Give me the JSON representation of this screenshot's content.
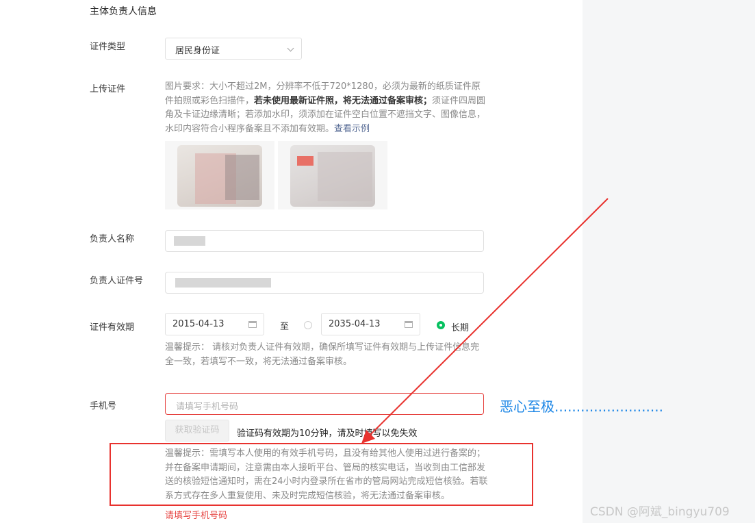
{
  "section_title": "主体负责人信息",
  "id_type": {
    "label": "证件类型",
    "value": "居民身份证"
  },
  "upload": {
    "label": "上传证件",
    "hint_part1": "图片要求：大小不超过2M，分辨率不低于720*1280，必须为最新的纸质证件原件拍照或彩色扫描件，",
    "hint_bold": "若未使用最新证件照，将无法通过备案审核；",
    "hint_part2": "须证件四周圆角及卡证边缘清晰；若添加水印，须添加在证件空白位置不遮挡文字、图像信息，水印内容符合小程序备案且不添加有效期。",
    "example_link": "查看示例"
  },
  "owner_name": {
    "label": "负责人名称"
  },
  "owner_id_number": {
    "label": "负责人证件号"
  },
  "validity": {
    "label": "证件有效期",
    "start_date": "2015-04-13",
    "separator": "至",
    "end_date": "2035-04-13",
    "long_term_label": "长期",
    "long_term_selected": true,
    "hint": "温馨提示： 请核对负责人证件有效期，确保所填写证件有效期与上传证件信息完全一致，若填写不一致，将无法通过备案审核。"
  },
  "phone": {
    "label": "手机号",
    "placeholder": "请填写手机号码",
    "get_code_button": "获取验证码",
    "code_validity_note": "验证码有效期为10分钟，请及时填写以免失效",
    "tip": "温馨提示：需填写本人使用的有效手机号码，且没有给其他人使用过进行备案的；并在备案申请期间，注意需由本人接听平台、管局的核实电话，当收到由工信部发送的核验短信通知时，需在24小时内登录所在省市的管局网站完成短信核验。若联系方式存在多人重复使用、未及时完成短信核验，将无法通过备案审核。",
    "error": "请填写手机号码"
  },
  "annotation": "恶心至极.........................",
  "watermark": "CSDN @阿斌_bingyu709",
  "colors": {
    "error": "#e64340",
    "radio_on": "#07c160",
    "annotation": "#1c86e6",
    "arrow": "#e8322e"
  }
}
